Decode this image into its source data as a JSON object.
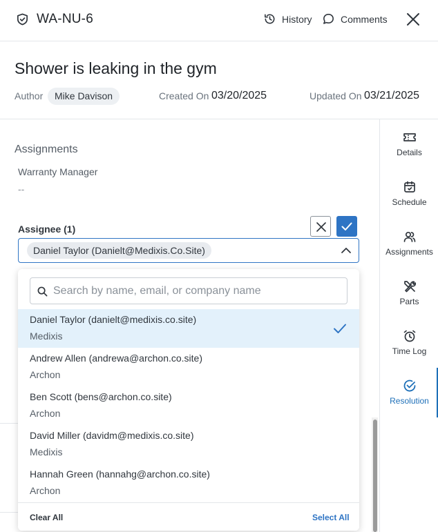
{
  "header": {
    "ticket_id": "WA-NU-6",
    "history_label": "History",
    "comments_label": "Comments"
  },
  "ticket": {
    "title": "Shower is leaking in the gym",
    "author_label": "Author",
    "author_name": "Mike Davison",
    "created_label": "Created On",
    "created_value": "03/20/2025",
    "updated_label": "Updated On",
    "updated_value": "03/21/2025"
  },
  "assignments": {
    "section_title": "Assignments",
    "warranty_manager_label": "Warranty Manager",
    "warranty_manager_value": "--",
    "assignee_label": "Assignee (1)",
    "selected_chip": "Daniel Taylor (Danielt@Medixis.Co.Site)"
  },
  "dropdown": {
    "search_placeholder": "Search by name, email, or company name",
    "options": [
      {
        "name": "Daniel Taylor (danielt@medixis.co.site)",
        "company": "Medixis",
        "selected": true
      },
      {
        "name": "Andrew Allen (andrewa@archon.co.site)",
        "company": "Archon",
        "selected": false
      },
      {
        "name": "Ben Scott (bens@archon.co.site)",
        "company": "Archon",
        "selected": false
      },
      {
        "name": "David Miller (davidm@medixis.co.site)",
        "company": "Medixis",
        "selected": false
      },
      {
        "name": "Hannah Green (hannahg@archon.co.site)",
        "company": "Archon",
        "selected": false
      }
    ],
    "clear_all_label": "Clear All",
    "select_all_label": "Select All"
  },
  "rail": {
    "items": [
      {
        "label": "Details",
        "icon": "ticket-icon"
      },
      {
        "label": "Schedule",
        "icon": "calendar-icon"
      },
      {
        "label": "Assignments",
        "icon": "users-icon"
      },
      {
        "label": "Parts",
        "icon": "tools-icon"
      },
      {
        "label": "Time Log",
        "icon": "alarm-clock-icon"
      },
      {
        "label": "Resolution",
        "icon": "check-badge-icon",
        "active": true
      }
    ]
  },
  "colors": {
    "accent": "#2e74c4",
    "active_rail": "#1d6fb8",
    "selected_row": "#e3f1fb"
  }
}
